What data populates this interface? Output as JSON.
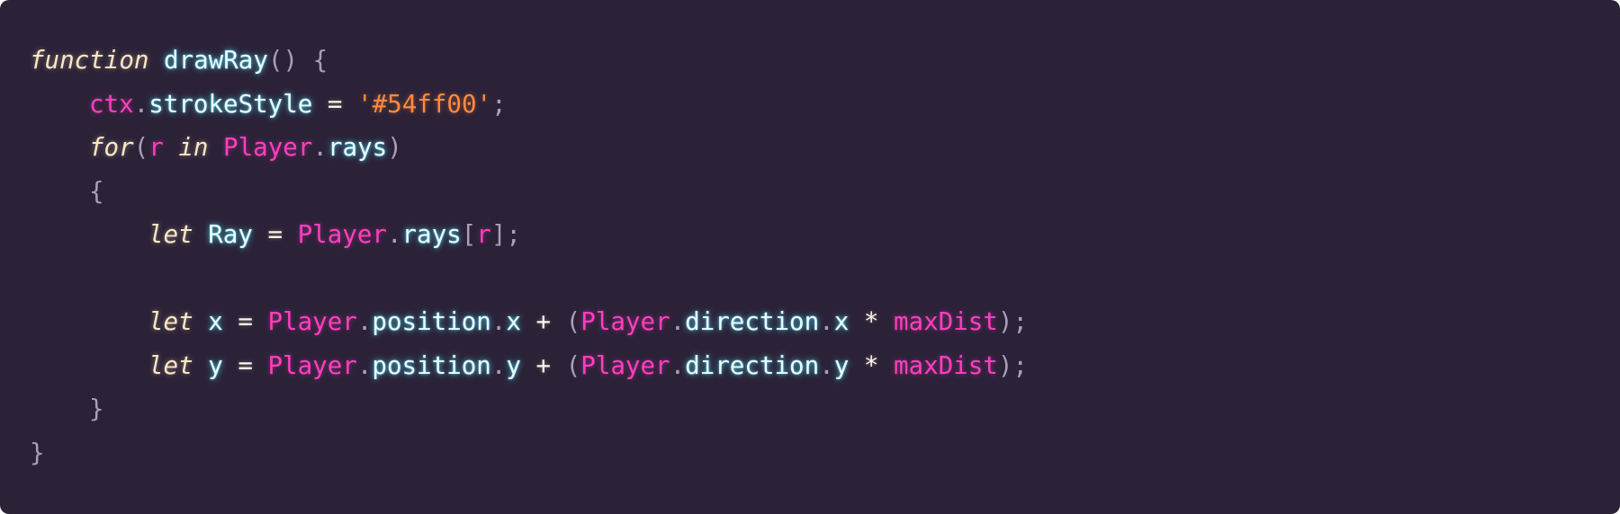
{
  "colors": {
    "background": "#2b2238",
    "keyword": "#fde7c2",
    "identifier": "#e8fdff",
    "identifier_glow": "#58e6ff",
    "object": "#ff3fbf",
    "string": "#ff8a3c",
    "punctuation": "#a89fba"
  },
  "code": {
    "line1": {
      "kw_function": "function",
      "fn_name": "drawRay",
      "paren_open_close": "()",
      "brace_open": "{"
    },
    "line2": {
      "obj_ctx": "ctx",
      "dot": ".",
      "prop_strokeStyle": "strokeStyle",
      "assign": "=",
      "string_color": "'#54ff00'",
      "semi": ";"
    },
    "line3": {
      "kw_for": "for",
      "paren_open": "(",
      "var_r": "r",
      "kw_in": "in",
      "obj_player": "Player",
      "dot": ".",
      "prop_rays": "rays",
      "paren_close": ")"
    },
    "line4": {
      "brace_open": "{"
    },
    "line5": {
      "kw_let": "let",
      "ident_ray": "Ray",
      "assign": "=",
      "obj_player": "Player",
      "dot": ".",
      "prop_rays": "rays",
      "bracket_open": "[",
      "var_r": "r",
      "bracket_close": "]",
      "semi": ";"
    },
    "line7": {
      "kw_let": "let",
      "ident_x": "x",
      "assign": "=",
      "obj_player_1": "Player",
      "dot_1": ".",
      "prop_position": "position",
      "dot_2": ".",
      "prop_x_1": "x",
      "plus": "+",
      "paren_open": "(",
      "obj_player_2": "Player",
      "dot_3": ".",
      "prop_direction": "direction",
      "dot_4": ".",
      "prop_x_2": "x",
      "mult": "*",
      "var_maxDist": "maxDist",
      "paren_close_semi": ");"
    },
    "line8": {
      "kw_let": "let",
      "ident_y": "y",
      "assign": "=",
      "obj_player_1": "Player",
      "dot_1": ".",
      "prop_position": "position",
      "dot_2": ".",
      "prop_y_1": "y",
      "plus": "+",
      "paren_open": "(",
      "obj_player_2": "Player",
      "dot_3": ".",
      "prop_direction": "direction",
      "dot_4": ".",
      "prop_y_2": "y",
      "mult": "*",
      "var_maxDist": "maxDist",
      "paren_close_semi": ");"
    },
    "line9": {
      "brace_close": "}"
    },
    "line10": {
      "brace_close": "}"
    }
  }
}
